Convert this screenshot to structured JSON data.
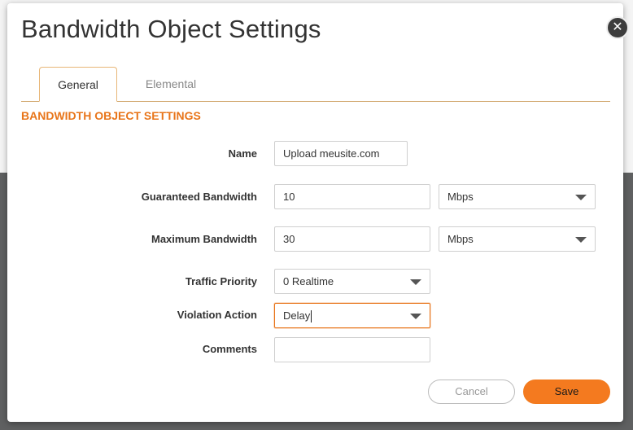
{
  "dialog": {
    "title": "Bandwidth Object Settings",
    "close_symbol": "✕"
  },
  "tabs": [
    {
      "label": "General",
      "active": true
    },
    {
      "label": "Elemental",
      "active": false
    }
  ],
  "section_title": "BANDWIDTH OBJECT SETTINGS",
  "form": {
    "name": {
      "label": "Name",
      "value": "Upload meusite.com"
    },
    "guaranteed_bandwidth": {
      "label": "Guaranteed Bandwidth",
      "value": "10",
      "unit": "Mbps"
    },
    "maximum_bandwidth": {
      "label": "Maximum Bandwidth",
      "value": "30",
      "unit": "Mbps"
    },
    "traffic_priority": {
      "label": "Traffic Priority",
      "value": "0 Realtime"
    },
    "violation_action": {
      "label": "Violation Action",
      "value": "Delay"
    },
    "comments": {
      "label": "Comments",
      "value": ""
    }
  },
  "buttons": {
    "cancel": "Cancel",
    "save": "Save"
  },
  "colors": {
    "accent": "#e8751a",
    "save_button": "#f47a1f",
    "overlay": "#5f6061"
  }
}
